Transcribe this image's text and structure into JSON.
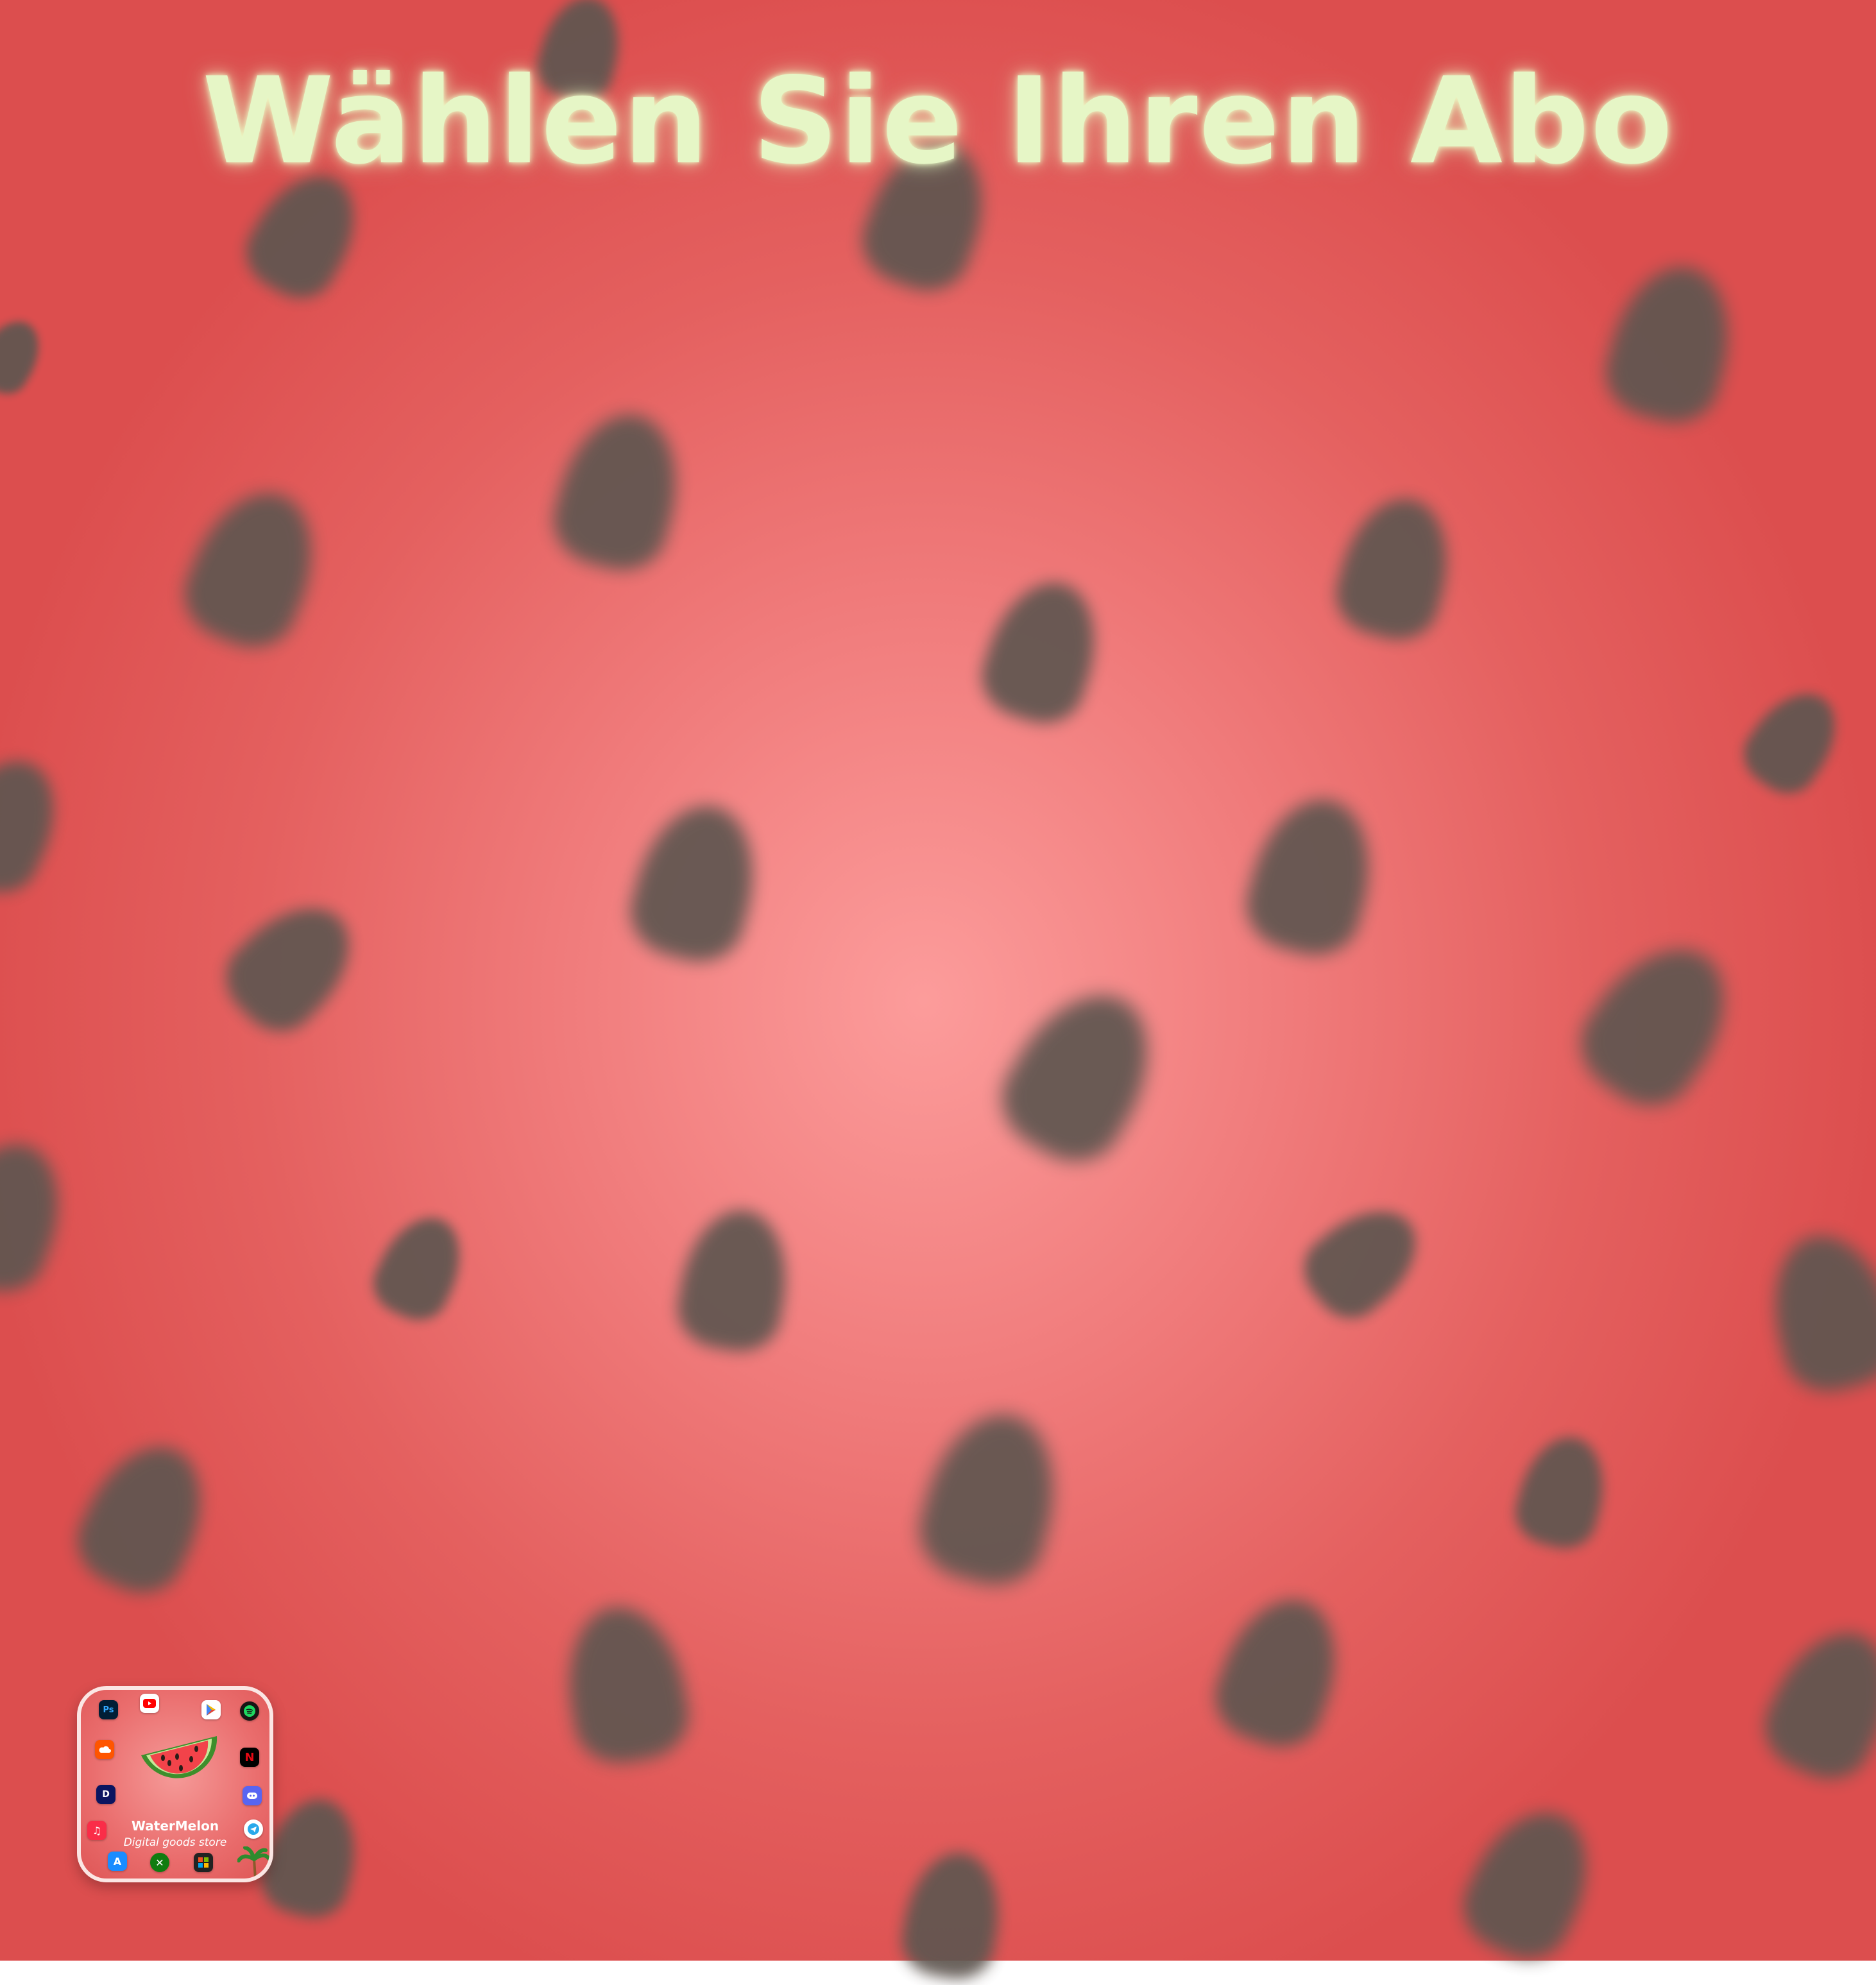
{
  "header": {
    "title": "Wählen Sie Ihren Abo"
  },
  "logo": {
    "brand_name": "WaterMelon",
    "tagline": "Digital goods store",
    "icons": [
      "photoshop-icon",
      "youtube-icon",
      "google-play-icon",
      "spotify-icon",
      "soundcloud-icon",
      "netflix-icon",
      "disney-plus-icon",
      "discord-icon",
      "apple-music-icon",
      "telegram-icon",
      "app-store-icon",
      "xbox-icon",
      "microsoft-icon",
      "palm-tree-icon",
      "watermelon-slice-icon"
    ]
  },
  "colors": {
    "background_center": "#fc9c9b",
    "background_edge": "#dc4e4e",
    "seed": "#5f5650",
    "title": "#e6f6c6"
  }
}
